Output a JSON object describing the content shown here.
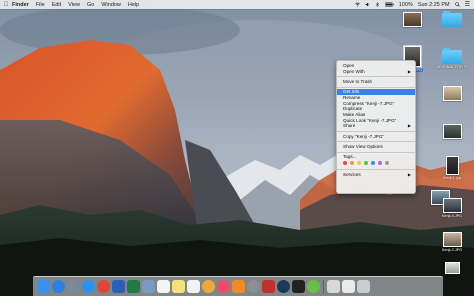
{
  "menubar": {
    "apple_icon": "apple-logo-icon",
    "app_name": "Finder",
    "items": [
      "File",
      "Edit",
      "View",
      "Go",
      "Window",
      "Help"
    ],
    "clock": "Sun 2:25 PM",
    "battery": "100%",
    "status_icons": [
      "wifi-icon",
      "volume-icon",
      "bluetooth-icon",
      "battery-icon",
      "search-icon",
      "list-icon"
    ]
  },
  "desktop": {
    "icons": [
      {
        "label": "",
        "kind": "image"
      },
      {
        "label": "",
        "kind": "folder"
      },
      {
        "label": "Kenji-7.JPG",
        "kind": "image",
        "selected": true
      },
      {
        "label": "ORIGINAL FONTS",
        "kind": "folder"
      },
      {
        "label": "",
        "kind": "image"
      },
      {
        "label": "",
        "kind": "image"
      },
      {
        "label": "Kenji-1.jpg",
        "kind": "image"
      },
      {
        "label": "",
        "kind": "image"
      },
      {
        "label": "Kenji-4.JPG",
        "kind": "image"
      },
      {
        "label": "Kenji-2.JPG",
        "kind": "image"
      },
      {
        "label": "",
        "kind": "image"
      }
    ]
  },
  "context_menu": {
    "items": [
      {
        "label": "Open"
      },
      {
        "label": "Open With",
        "submenu": true
      },
      {
        "sep": true
      },
      {
        "label": "Move to Trash"
      },
      {
        "sep": true
      },
      {
        "label": "Get Info",
        "active": true
      },
      {
        "label": "Rename"
      },
      {
        "label": "Compress \"Kenji -7.JPG\""
      },
      {
        "label": "Duplicate"
      },
      {
        "label": "Make Alias"
      },
      {
        "label": "Quick Look \"Kenji -7.JPG\""
      },
      {
        "label": "Share",
        "submenu": true
      },
      {
        "sep": true
      },
      {
        "label": "Copy \"Kenji -7.JPG\""
      },
      {
        "sep": true
      },
      {
        "label": "Show View Options"
      },
      {
        "sep": true
      },
      {
        "label": "Tags..."
      },
      {
        "tags": true
      },
      {
        "sep": true
      },
      {
        "label": "Services",
        "submenu": true
      }
    ],
    "tag_colors": [
      "#f0463b",
      "#f59a32",
      "#f5cc2e",
      "#52c43d",
      "#3b8cf2",
      "#b065d6",
      "#9a9a9a"
    ]
  },
  "dock": {
    "apps": [
      {
        "name": "finder-icon",
        "color": "#3b8ff0"
      },
      {
        "name": "safari-icon",
        "color": "#2f7fe0",
        "round": true
      },
      {
        "name": "launchpad-icon",
        "color": "#7a8a9a",
        "round": true
      },
      {
        "name": "app-store-icon",
        "color": "#2a93f0",
        "round": true
      },
      {
        "name": "chrome-icon",
        "color": "#e0453a",
        "round": true
      },
      {
        "name": "word-icon",
        "color": "#2b5fb8"
      },
      {
        "name": "excel-icon",
        "color": "#1f7a43"
      },
      {
        "name": "preview-icon",
        "color": "#7a9ac2"
      },
      {
        "name": "calendar-icon",
        "color": "#f4f4f4"
      },
      {
        "name": "notes-icon",
        "color": "#f6e27a"
      },
      {
        "name": "reminders-icon",
        "color": "#f2f2f2"
      },
      {
        "name": "photos-icon",
        "color": "#f0a83c",
        "round": true
      },
      {
        "name": "music-icon",
        "color": "#f04a6a",
        "round": true
      },
      {
        "name": "books-icon",
        "color": "#f08a2a"
      },
      {
        "name": "system-preferences-icon",
        "color": "#8a8f96",
        "round": true
      },
      {
        "name": "photo-booth-icon",
        "color": "#c23030"
      },
      {
        "name": "steam-icon",
        "color": "#1b3a5a",
        "round": true
      },
      {
        "name": "terminal-icon",
        "color": "#222222"
      },
      {
        "name": "app-green-icon",
        "color": "#6bbd45",
        "round": true
      },
      {
        "name": "downloads-stack-icon",
        "color": "#d8d8d8"
      },
      {
        "name": "documents-stack-icon",
        "color": "#eaeaea"
      },
      {
        "name": "trash-icon",
        "color": "#c8cdd2"
      }
    ]
  }
}
